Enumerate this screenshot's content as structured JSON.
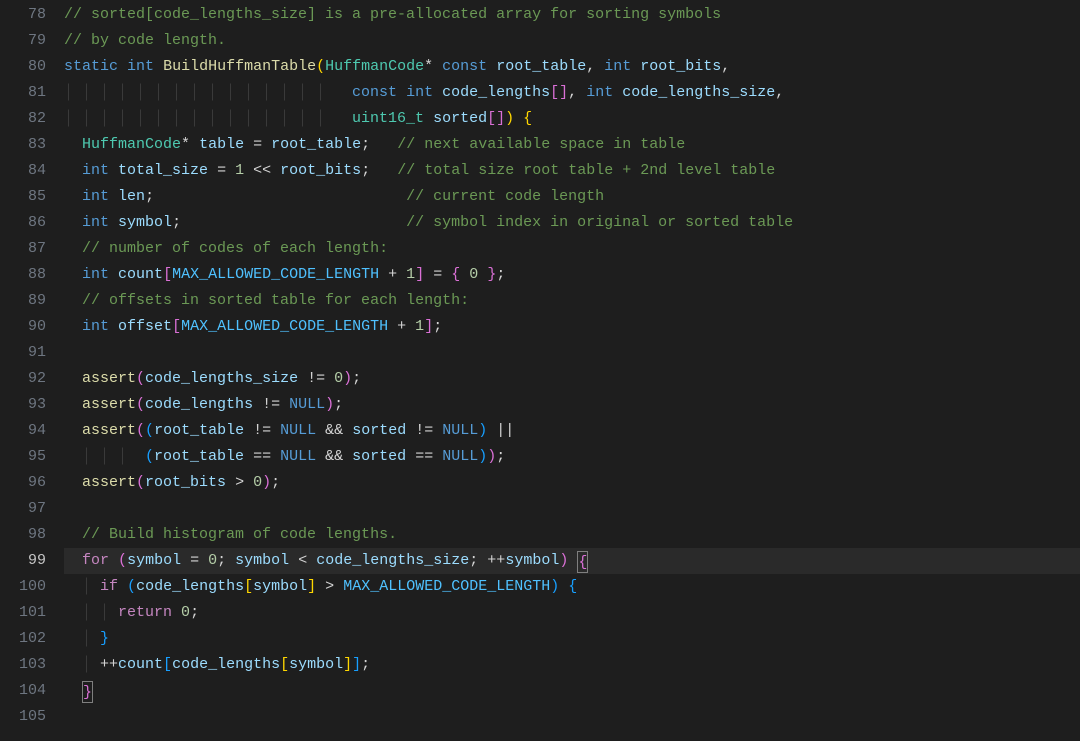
{
  "editor": {
    "first_line_number": 78,
    "current_line_number": 99,
    "marked_line_number": 98,
    "cursor": {
      "line": 99,
      "col_after_token": "{",
      "style": "box"
    },
    "comments": {
      "l78": "// sorted[code_lengths_size] is a pre-allocated array for sorting symbols",
      "l79": "// by code length.",
      "l83": "// next available space in table",
      "l84": "// total size root table + 2nd level table",
      "l85": "// current code length",
      "l86": "// symbol index in original or sorted table",
      "l87": "// number of codes of each length:",
      "l89": "// offsets in sorted table for each length:",
      "l98": "// Build histogram of code lengths."
    },
    "kw": {
      "static": "static",
      "int": "int",
      "const": "const",
      "for": "for",
      "if": "if",
      "return": "return"
    },
    "types": {
      "HuffmanCode": "HuffmanCode",
      "uint16_t": "uint16_t"
    },
    "funcs": {
      "BuildHuffmanTable": "BuildHuffmanTable",
      "assert": "assert"
    },
    "idents": {
      "root_table": "root_table",
      "root_bits": "root_bits",
      "code_lengths": "code_lengths",
      "code_lengths_size": "code_lengths_size",
      "sorted": "sorted",
      "table": "table",
      "total_size": "total_size",
      "len": "len",
      "symbol": "symbol",
      "count": "count",
      "offset": "offset",
      "NULL": "NULL",
      "MAX_ALLOWED_CODE_LENGTH": "MAX_ALLOWED_CODE_LENGTH"
    },
    "nums": {
      "zero": "0",
      "one": "1"
    },
    "punc": {
      "star": "*",
      "eq": "=",
      "lt": "<",
      "gt": ">",
      "semicolon": ";",
      "comma": ",",
      "lparen": "(",
      "rparen": ")",
      "lbrack": "[",
      "rbrack": "]",
      "lbrace": "{",
      "rbrace": "}",
      "plus": "+",
      "bang": "!",
      "amp": "&",
      "pipe": "|",
      "shiftl": "<<",
      "neq": "!=",
      "eqeq": "==",
      "plusplus": "++",
      "and": "&&",
      "or": "||"
    },
    "line_numbers": [
      "78",
      "79",
      "80",
      "81",
      "82",
      "83",
      "84",
      "85",
      "86",
      "87",
      "88",
      "89",
      "90",
      "91",
      "92",
      "93",
      "94",
      "95",
      "96",
      "97",
      "98",
      "99",
      "100",
      "101",
      "102",
      "103",
      "104",
      "105"
    ]
  }
}
